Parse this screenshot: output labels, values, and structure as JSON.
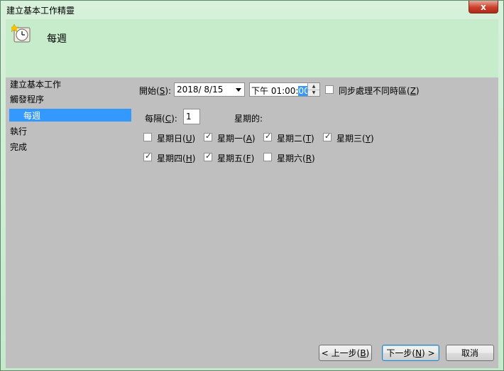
{
  "window": {
    "title": "建立基本工作精靈"
  },
  "header": {
    "title": "每週",
    "icon": "clock-icon"
  },
  "nav": {
    "items": [
      "建立基本工作",
      "觸發程序",
      "每週",
      "執行",
      "完成"
    ],
    "selected": 2
  },
  "start": {
    "label": "開始(",
    "key": "S",
    "label_end": "):",
    "date": "2018/  8/15",
    "time_prefix": "下午 01:00:",
    "time_selected": "00"
  },
  "sync_tz": {
    "label": "同步處理不同時區(",
    "key": "Z",
    "label_end": ")",
    "checked": false
  },
  "every": {
    "label": "每隔(",
    "key": "C",
    "label_end": "):",
    "value": "1",
    "days_label": "星期的:"
  },
  "days": [
    {
      "label": "星期日(",
      "key": "U",
      "end": ")",
      "checked": false
    },
    {
      "label": "星期一(",
      "key": "A",
      "end": ")",
      "checked": true
    },
    {
      "label": "星期二(",
      "key": "T",
      "end": ")",
      "checked": true
    },
    {
      "label": "星期三(",
      "key": "Y",
      "end": ")",
      "checked": true
    },
    {
      "label": "星期四(",
      "key": "H",
      "end": ")",
      "checked": true
    },
    {
      "label": "星期五(",
      "key": "F",
      "end": ")",
      "checked": true
    },
    {
      "label": "星期六(",
      "key": "R",
      "end": ")",
      "checked": false
    }
  ],
  "buttons": {
    "back": {
      "label": "< 上一步(",
      "key": "B",
      "end": ")"
    },
    "next": {
      "label": "下一步(",
      "key": "N",
      "end": ") >"
    },
    "cancel": {
      "label": "取消"
    }
  },
  "close_label": "x"
}
